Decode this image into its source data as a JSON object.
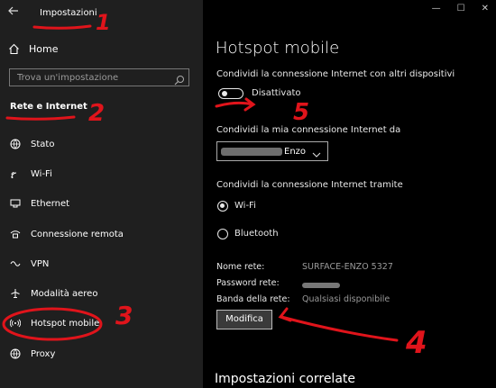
{
  "window": {
    "title": "Impostazioni",
    "controls": [
      "—",
      "☐",
      "✕"
    ]
  },
  "sidebar": {
    "home_label": "Home",
    "search_placeholder": "Trova un'impostazione",
    "section_title": "Rete e Internet",
    "items": [
      {
        "label": "Stato",
        "icon": "globe-icon"
      },
      {
        "label": "Wi-Fi",
        "icon": "wifi-icon"
      },
      {
        "label": "Ethernet",
        "icon": "ethernet-icon"
      },
      {
        "label": "Connessione remota",
        "icon": "dialup-icon"
      },
      {
        "label": "VPN",
        "icon": "vpn-icon"
      },
      {
        "label": "Modalità aereo",
        "icon": "airplane-icon"
      },
      {
        "label": "Hotspot mobile",
        "icon": "hotspot-icon"
      },
      {
        "label": "Proxy",
        "icon": "globe-icon"
      }
    ]
  },
  "main": {
    "title": "Hotspot mobile",
    "share_label": "Condividi la connessione Internet con altri dispositivi",
    "toggle_state": "Disattivato",
    "share_from_label": "Condividi la mia connessione Internet da",
    "share_from_value": "Enzo",
    "share_via_label": "Condividi la connessione Internet tramite",
    "radio_options": [
      {
        "label": "Wi-Fi",
        "selected": true
      },
      {
        "label": "Bluetooth",
        "selected": false
      }
    ],
    "network_name_key": "Nome rete:",
    "network_name_value": "SURFACE-ENZO 5327",
    "password_key": "Password rete:",
    "band_key": "Banda della rete:",
    "band_value": "Qualsiasi disponibile",
    "edit_button": "Modifica",
    "related_title": "Impostazioni correlate"
  },
  "annotations": {
    "numbers": [
      "1",
      "2",
      "3",
      "4",
      "5"
    ],
    "color": "#e0141b"
  }
}
